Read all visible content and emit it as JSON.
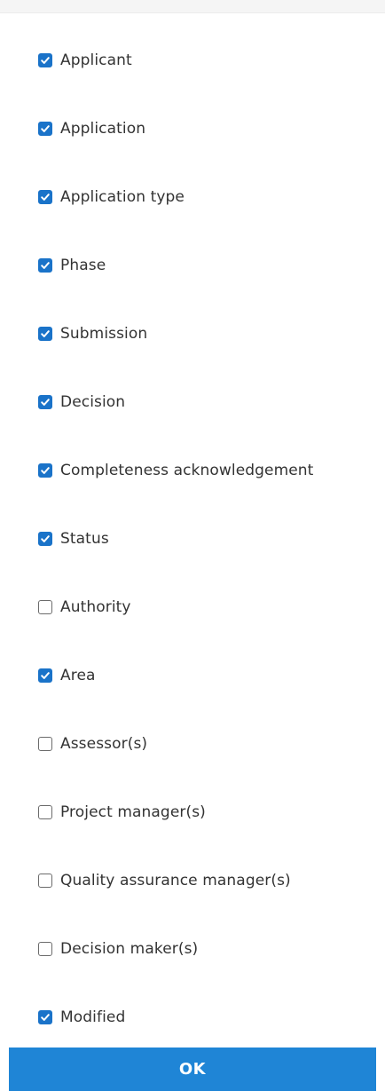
{
  "columns": [
    {
      "label": "Applicant",
      "checked": true
    },
    {
      "label": "Application",
      "checked": true
    },
    {
      "label": "Application type",
      "checked": true
    },
    {
      "label": "Phase",
      "checked": true
    },
    {
      "label": "Submission",
      "checked": true
    },
    {
      "label": "Decision",
      "checked": true
    },
    {
      "label": "Completeness acknowledgement",
      "checked": true
    },
    {
      "label": "Status",
      "checked": true
    },
    {
      "label": "Authority",
      "checked": false
    },
    {
      "label": "Area",
      "checked": true
    },
    {
      "label": "Assessor(s)",
      "checked": false
    },
    {
      "label": "Project manager(s)",
      "checked": false
    },
    {
      "label": "Quality assurance manager(s)",
      "checked": false
    },
    {
      "label": "Decision maker(s)",
      "checked": false
    },
    {
      "label": "Modified",
      "checked": true
    }
  ],
  "ok_button": {
    "label": "OK"
  },
  "colors": {
    "accent": "#1a73c9",
    "button": "#1f85d6",
    "text": "#333333"
  },
  "icons": {
    "checked": "checkmark-icon"
  }
}
